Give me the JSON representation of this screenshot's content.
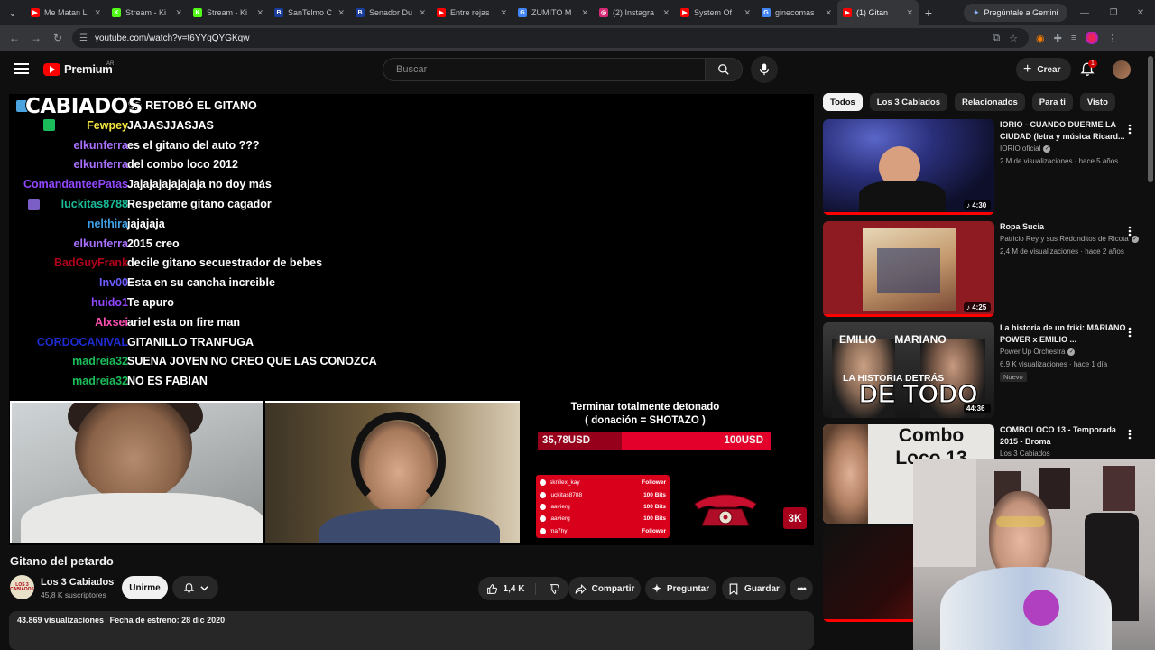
{
  "browser": {
    "tabs": [
      {
        "title": "Me Matan L",
        "favicon_color": "#ff0000",
        "favicon_glyph": "▶"
      },
      {
        "title": "Stream - Ki",
        "favicon_color": "#53fc18",
        "favicon_glyph": "K"
      },
      {
        "title": "Stream - Ki",
        "favicon_color": "#53fc18",
        "favicon_glyph": "K"
      },
      {
        "title": "SanTelmo C",
        "favicon_color": "#1a3d9c",
        "favicon_glyph": "B"
      },
      {
        "title": "Senador Du",
        "favicon_color": "#1a3d9c",
        "favicon_glyph": "B"
      },
      {
        "title": "Entre rejas",
        "favicon_color": "#ff0000",
        "favicon_glyph": "▶"
      },
      {
        "title": "ZUMITO M",
        "favicon_color": "#4285f4",
        "favicon_glyph": "G"
      },
      {
        "title": "(2) Instagra",
        "favicon_color": "#d62976",
        "favicon_glyph": "◎"
      },
      {
        "title": "System Of",
        "favicon_color": "#ff0000",
        "favicon_glyph": "▶"
      },
      {
        "title": "ginecomas",
        "favicon_color": "#4285f4",
        "favicon_glyph": "G"
      },
      {
        "title": "(1) Gitan",
        "favicon_color": "#ff0000",
        "favicon_glyph": "▶",
        "active": true
      }
    ],
    "gemini_label": "Pregúntale a Gemini",
    "url": "youtube.com/watch?v=t6YYgQYGKqw"
  },
  "header": {
    "brand": "Premium",
    "country": "AR",
    "search_placeholder": "Buscar",
    "create_label": "Crear",
    "notifications_count": "1"
  },
  "player": {
    "logo_text": "CABIADOS",
    "chat": [
      {
        "user": "",
        "user_color": "#ffffff",
        "message": "SE RETOBÓ EL GITANO",
        "badge": true,
        "badge_color": "#4aa3df"
      },
      {
        "user": "Fewpey",
        "user_color": "#f5e642",
        "message": "JAJASJJASJAS",
        "badge": true,
        "badge_color": "#1bbc5a"
      },
      {
        "user": "elkunferra",
        "user_color": "#a970ff",
        "message": "es el gitano del auto ???"
      },
      {
        "user": "elkunferra",
        "user_color": "#a970ff",
        "message": "del combo loco 2012"
      },
      {
        "user": "ComandanteePatas",
        "user_color": "#9147ff",
        "message": "Jajajajajajajaja no doy más"
      },
      {
        "user": "luckitas8788",
        "user_color": "#1bbc9b",
        "message": "Respetame gitano cagador",
        "badge": true,
        "badge_color": "#7b5fc7"
      },
      {
        "user": "nelthira",
        "user_color": "#3f9fe6",
        "message": "jajajaja"
      },
      {
        "user": "elkunferra",
        "user_color": "#a970ff",
        "message": "2015 creo"
      },
      {
        "user": "BadGuyFrank",
        "user_color": "#b3001b",
        "message": "decile gitano secuestrador de bebes"
      },
      {
        "user": "Inv00",
        "user_color": "#6b5cff",
        "message": "Esta en su cancha increible"
      },
      {
        "user": "huido1",
        "user_color": "#9147ff",
        "message": "Te apuro"
      },
      {
        "user": "Alxsei",
        "user_color": "#ff4fb3",
        "message": "ariel esta on fire man"
      },
      {
        "user": "CORDOCANIVAL",
        "user_color": "#1e2bd1",
        "message": "GITANILLO TRANFUGA"
      },
      {
        "user": "madreia32",
        "user_color": "#1bbc5a",
        "message": "SUENA JOVEN NO CREO QUE LAS CONOZCA"
      },
      {
        "user": "madreia32",
        "user_color": "#1bbc5a",
        "message": "NO ES FABIAN"
      }
    ],
    "goal": {
      "title_line1": "Terminar totalmente detonado",
      "title_line2": "( donación = SHOTAZO )",
      "current": "35,78USD",
      "target": "100USD",
      "progress": 0.36
    },
    "events": [
      {
        "name": "skrillex_kay",
        "value": "Follower"
      },
      {
        "name": "luckitas8788",
        "value": "100 Bits"
      },
      {
        "name": "jaavierg",
        "value": "100 Bits"
      },
      {
        "name": "jaavierg",
        "value": "100 Bits"
      },
      {
        "name": "ma7hy",
        "value": "Follower"
      }
    ],
    "badge_3k": "3K"
  },
  "video": {
    "title": "Gitano del petardo",
    "channel": "Los 3 Cabiados",
    "channel_avatar_text": "LOS 3 CABIADOS",
    "subscribers": "45,8 K suscriptores",
    "join_label": "Unirme",
    "likes": "1,4 K",
    "share_label": "Compartir",
    "ask_label": "Preguntar",
    "save_label": "Guardar",
    "views": "43.869 visualizaciones",
    "premiere": "Fecha de estreno: 28 dic 2020"
  },
  "chips": [
    "Todos",
    "Los 3 Cabiados",
    "Relacionados",
    "Para ti",
    "Visto"
  ],
  "recommendations": [
    {
      "title": "IORIO -  CUANDO DUERME LA CIUDAD (letra y música Ricard...",
      "channel": "IORIO oficial",
      "verified": true,
      "meta": "2 M de visualizaciones · hace 5 años",
      "duration": "♪ 4:30",
      "progress": 1.0,
      "new": ""
    },
    {
      "title": "Ropa Sucia",
      "channel": "Patricio Rey y sus Redonditos de Ricota",
      "verified": true,
      "meta": "2,4 M de visualizaciones · hace 2 años",
      "duration": "♪ 4:25",
      "progress": 1.0,
      "new": ""
    },
    {
      "title": "La historia de un friki: MARIANO POWER x EMILIO ...",
      "channel": "Power Up Orchestra",
      "verified": true,
      "meta": "6,9 K visualizaciones · hace 1 día",
      "duration": "44:36",
      "progress": 0,
      "new": "Nuevo"
    },
    {
      "title": "COMBOLOCO 13 - Temporada 2015 - Broma",
      "channel": "Los 3 Cabiados",
      "verified": false,
      "meta": "",
      "duration": "",
      "progress": 0,
      "new": ""
    }
  ],
  "thumb_texts": {
    "rec3_names": "EMILIO      MARIANO",
    "rec3_line1": "LA HISTORIA DETRÁS",
    "rec3_line2": "DE TODO",
    "rec4_line": "Combo Loco 13"
  }
}
